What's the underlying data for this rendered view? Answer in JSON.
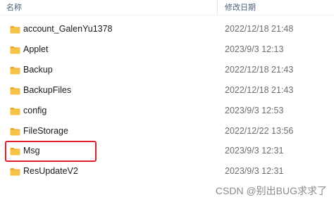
{
  "header": {
    "name_column": "名称",
    "date_column": "修改日期"
  },
  "files": [
    {
      "name": "account_GalenYu1378",
      "date": "2022/12/18 21:48"
    },
    {
      "name": "Applet",
      "date": "2023/9/3 12:13"
    },
    {
      "name": "Backup",
      "date": "2022/12/18 21:43"
    },
    {
      "name": "BackupFiles",
      "date": "2022/12/18 21:43"
    },
    {
      "name": "config",
      "date": "2023/9/3 12:53"
    },
    {
      "name": "FileStorage",
      "date": "2022/12/22 13:56"
    },
    {
      "name": "Msg",
      "date": "2023/9/3 12:31"
    },
    {
      "name": "ResUpdateV2",
      "date": "2023/9/3 12:31"
    }
  ],
  "icons": {
    "folder": "folder-icon"
  },
  "colors": {
    "folder_fill": "#f6c346",
    "folder_tab": "#e9a82c",
    "highlight": "#e0202b"
  },
  "watermark": "CSDN @别出BUG求求了"
}
